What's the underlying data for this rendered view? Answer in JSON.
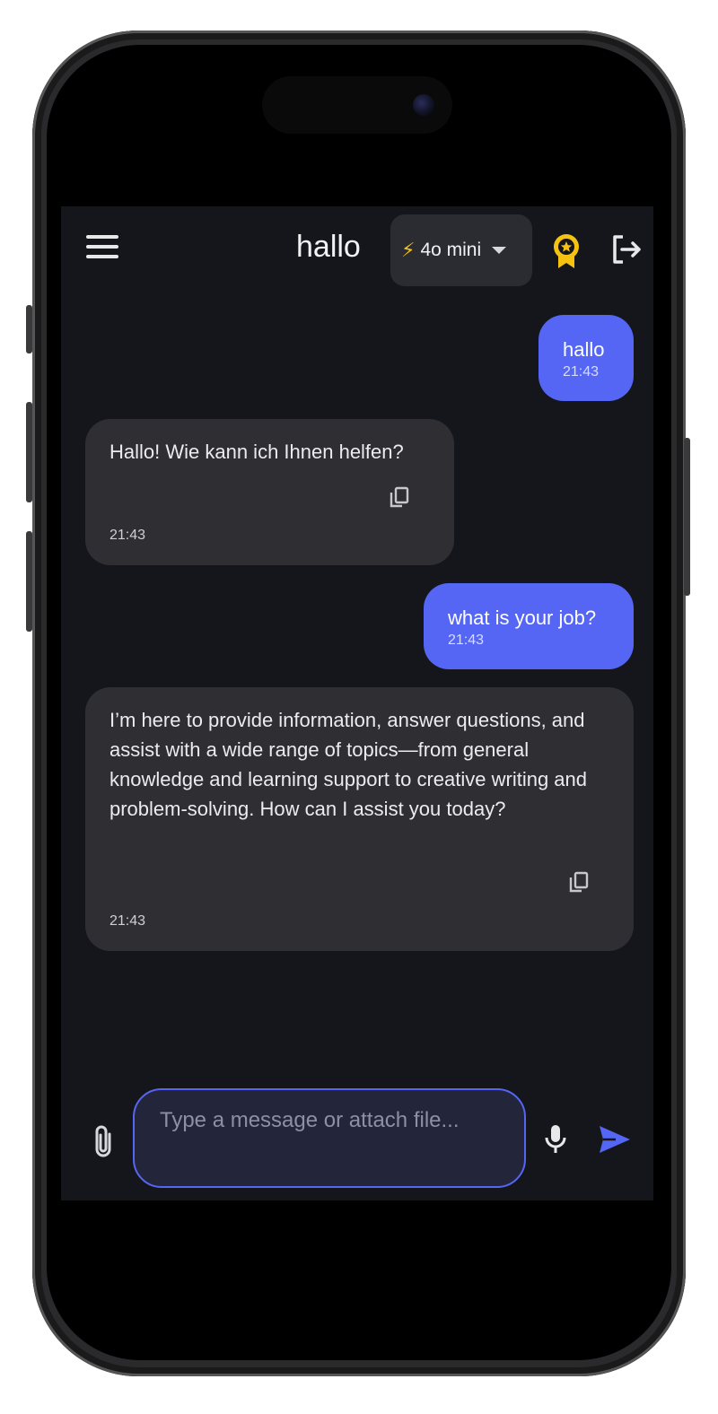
{
  "header": {
    "title": "hallo",
    "model_label": "4o mini",
    "model_icon": "lightning-bolt",
    "menu_icon": "hamburger-menu",
    "award_icon": "award-badge",
    "logout_icon": "logout"
  },
  "messages": [
    {
      "role": "user",
      "text": "hallo",
      "time": "21:43"
    },
    {
      "role": "assistant",
      "text": "Hallo! Wie kann ich Ihnen helfen?",
      "time": "21:43"
    },
    {
      "role": "user",
      "text": "what is your job?",
      "time": "21:43"
    },
    {
      "role": "assistant",
      "text": "I’m here to provide information, answer questions, and assist with a wide range of topics—from general knowledge and learning support to creative writing and problem-solving. How can I assist you today?",
      "time": "21:43"
    }
  ],
  "composer": {
    "placeholder": "Type a message or attach file...",
    "attach_icon": "paperclip",
    "mic_icon": "microphone",
    "send_icon": "send-arrow"
  },
  "colors": {
    "accent": "#5566f4",
    "background": "#15161b",
    "bubble_assistant": "#2e2e33",
    "award": "#f5c211"
  }
}
